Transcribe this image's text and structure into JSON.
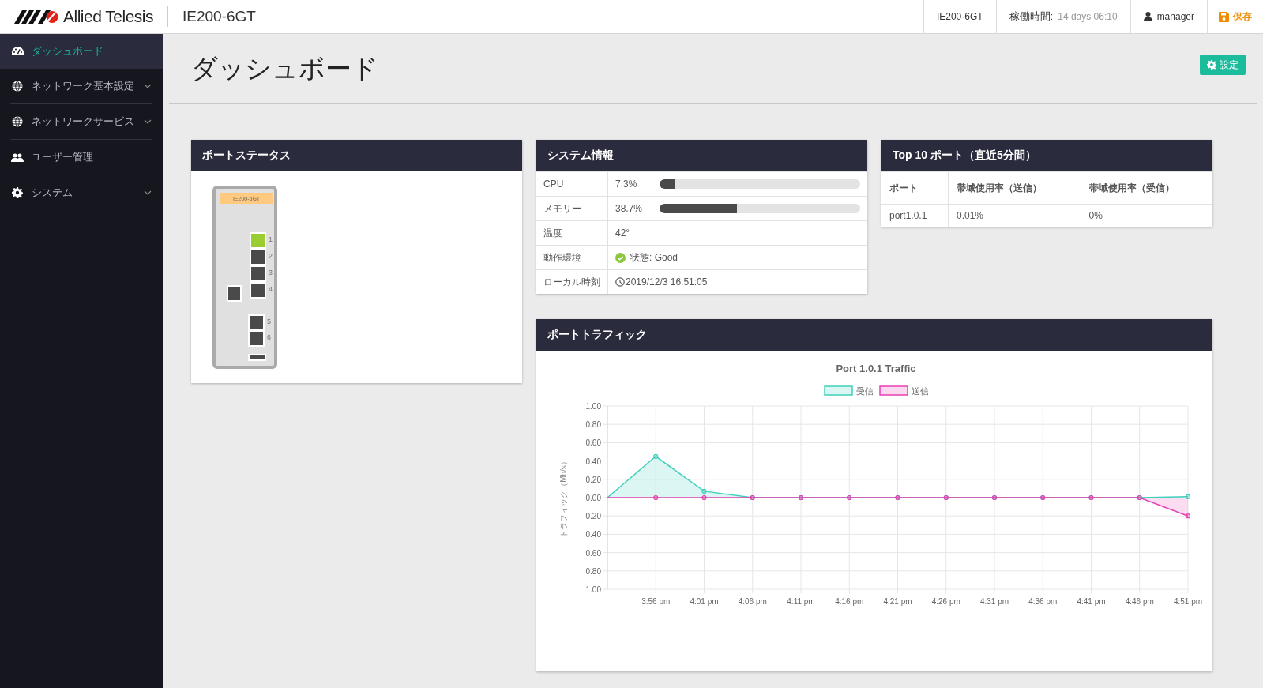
{
  "header": {
    "brand": "Allied Telesis",
    "model": "IE200-6GT",
    "device": "IE200-6GT",
    "uptime_label": "稼働時間:",
    "uptime": "14 days 06:10",
    "user": "manager",
    "save": "保存"
  },
  "sidebar": {
    "items": [
      {
        "label": "ダッシュボード",
        "selected": true,
        "expandable": false
      },
      {
        "label": "ネットワーク基本設定",
        "selected": false,
        "expandable": true
      },
      {
        "label": "ネットワークサービス",
        "selected": false,
        "expandable": true
      },
      {
        "label": "ユーザー管理",
        "selected": false,
        "expandable": false
      },
      {
        "label": "システム",
        "selected": false,
        "expandable": true
      }
    ]
  },
  "page": {
    "title": "ダッシュボード",
    "settings_button": "設定"
  },
  "port_status": {
    "title": "ポートステータス",
    "model_label": "IE200-6GT",
    "ports": [
      {
        "label": "1",
        "kind": "rj45",
        "up": true
      },
      {
        "label": "2",
        "kind": "rj45",
        "up": false
      },
      {
        "label": "3",
        "kind": "rj45",
        "up": false
      },
      {
        "label": "4",
        "kind": "rj45",
        "up": false
      },
      {
        "label": "5",
        "kind": "sfp",
        "up": false
      },
      {
        "label": "6",
        "kind": "sfp",
        "up": false
      }
    ]
  },
  "system_info": {
    "title": "システム情報",
    "rows": [
      {
        "label": "CPU",
        "kind": "meter",
        "value": "7.3%",
        "level": 0.073
      },
      {
        "label": "メモリー",
        "kind": "meter",
        "value": "38.7%",
        "level": 0.387
      },
      {
        "label": "温度",
        "kind": "text",
        "value": "42°"
      },
      {
        "label": "動作環境",
        "kind": "status",
        "value": "状態: Good"
      },
      {
        "label": "ローカル時刻",
        "kind": "time",
        "value": "2019/12/3 16:51:05"
      }
    ]
  },
  "top_ports": {
    "title": "Top 10 ポート（直近5分間）",
    "columns": [
      "ポート",
      "帯域使用率（送信）",
      "帯域使用率（受信）"
    ],
    "rows": [
      [
        "port1.0.1",
        "0.01%",
        "0%"
      ]
    ]
  },
  "traffic": {
    "title": "ポートトラフィック",
    "chart_data": {
      "type": "area",
      "title": "Port 1.0.1 Traffic",
      "ylabel": "トラフィック（Mb/s）",
      "categories": [
        null,
        "3:56 pm",
        "4:01 pm",
        "4:06 pm",
        "4:11 pm",
        "4:16 pm",
        "4:21 pm",
        "4:26 pm",
        "4:31 pm",
        "4:36 pm",
        "4:41 pm",
        "4:46 pm",
        "4:51 pm"
      ],
      "series": [
        {
          "name": "受信",
          "color": "#3fd0bc",
          "values": [
            0,
            0.45,
            0.07,
            0,
            0,
            0,
            0,
            0,
            0,
            0,
            0,
            0,
            0.01
          ]
        },
        {
          "name": "送信",
          "color": "#e83fb2",
          "values": [
            0,
            0,
            0,
            0,
            0,
            0,
            0,
            0,
            0,
            0,
            0,
            0,
            -0.2
          ]
        }
      ],
      "ylim": [
        -1,
        1
      ],
      "grid": true,
      "legend": true,
      "yticks": [
        {
          "value": 1,
          "label": "1.00"
        },
        {
          "value": 0.8,
          "label": "0.80"
        },
        {
          "value": 0.6,
          "label": "0.60"
        },
        {
          "value": 0.4,
          "label": "0.40"
        },
        {
          "value": 0.2,
          "label": "0.20"
        },
        {
          "value": 0,
          "label": "0.00"
        },
        {
          "value": -0.2,
          "label": "0.20"
        },
        {
          "value": -0.4,
          "label": "0.40"
        },
        {
          "value": -0.6,
          "label": "0.60"
        },
        {
          "value": -0.8,
          "label": "0.80"
        },
        {
          "value": -1,
          "label": "1.00"
        }
      ]
    }
  }
}
